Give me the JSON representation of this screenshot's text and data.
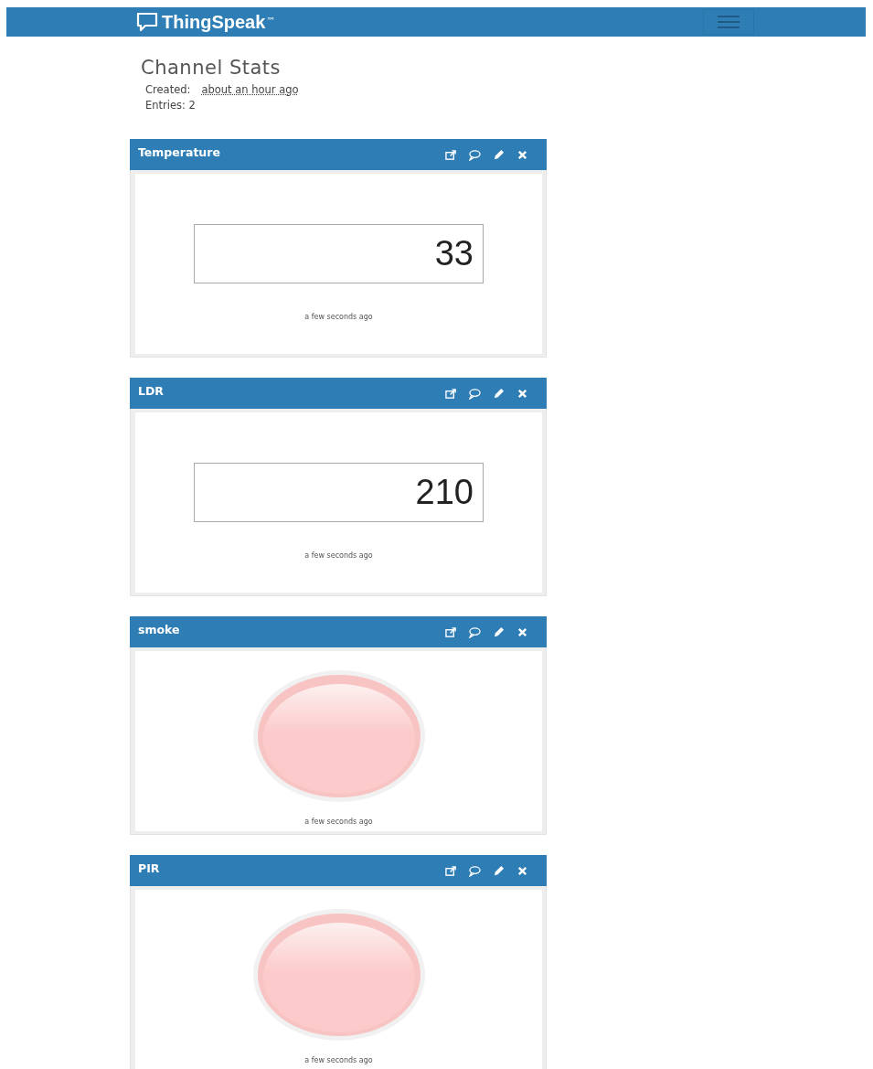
{
  "navbar": {
    "brand": "ThingSpeak",
    "trademark": "™"
  },
  "channel_stats": {
    "title": "Channel Stats",
    "created_label": "Created:",
    "created_value": "about an hour ago",
    "entries": "Entries: 2"
  },
  "widgets": [
    {
      "title": "Temperature",
      "kind": "numeric",
      "value": "33",
      "updated": "a few seconds ago"
    },
    {
      "title": "LDR",
      "kind": "numeric",
      "value": "210",
      "updated": "a few seconds ago"
    },
    {
      "title": "smoke",
      "kind": "lamp",
      "on": false,
      "updated": "a few seconds ago"
    },
    {
      "title": "PIR",
      "kind": "lamp",
      "on": false,
      "updated": "a few seconds ago"
    }
  ]
}
